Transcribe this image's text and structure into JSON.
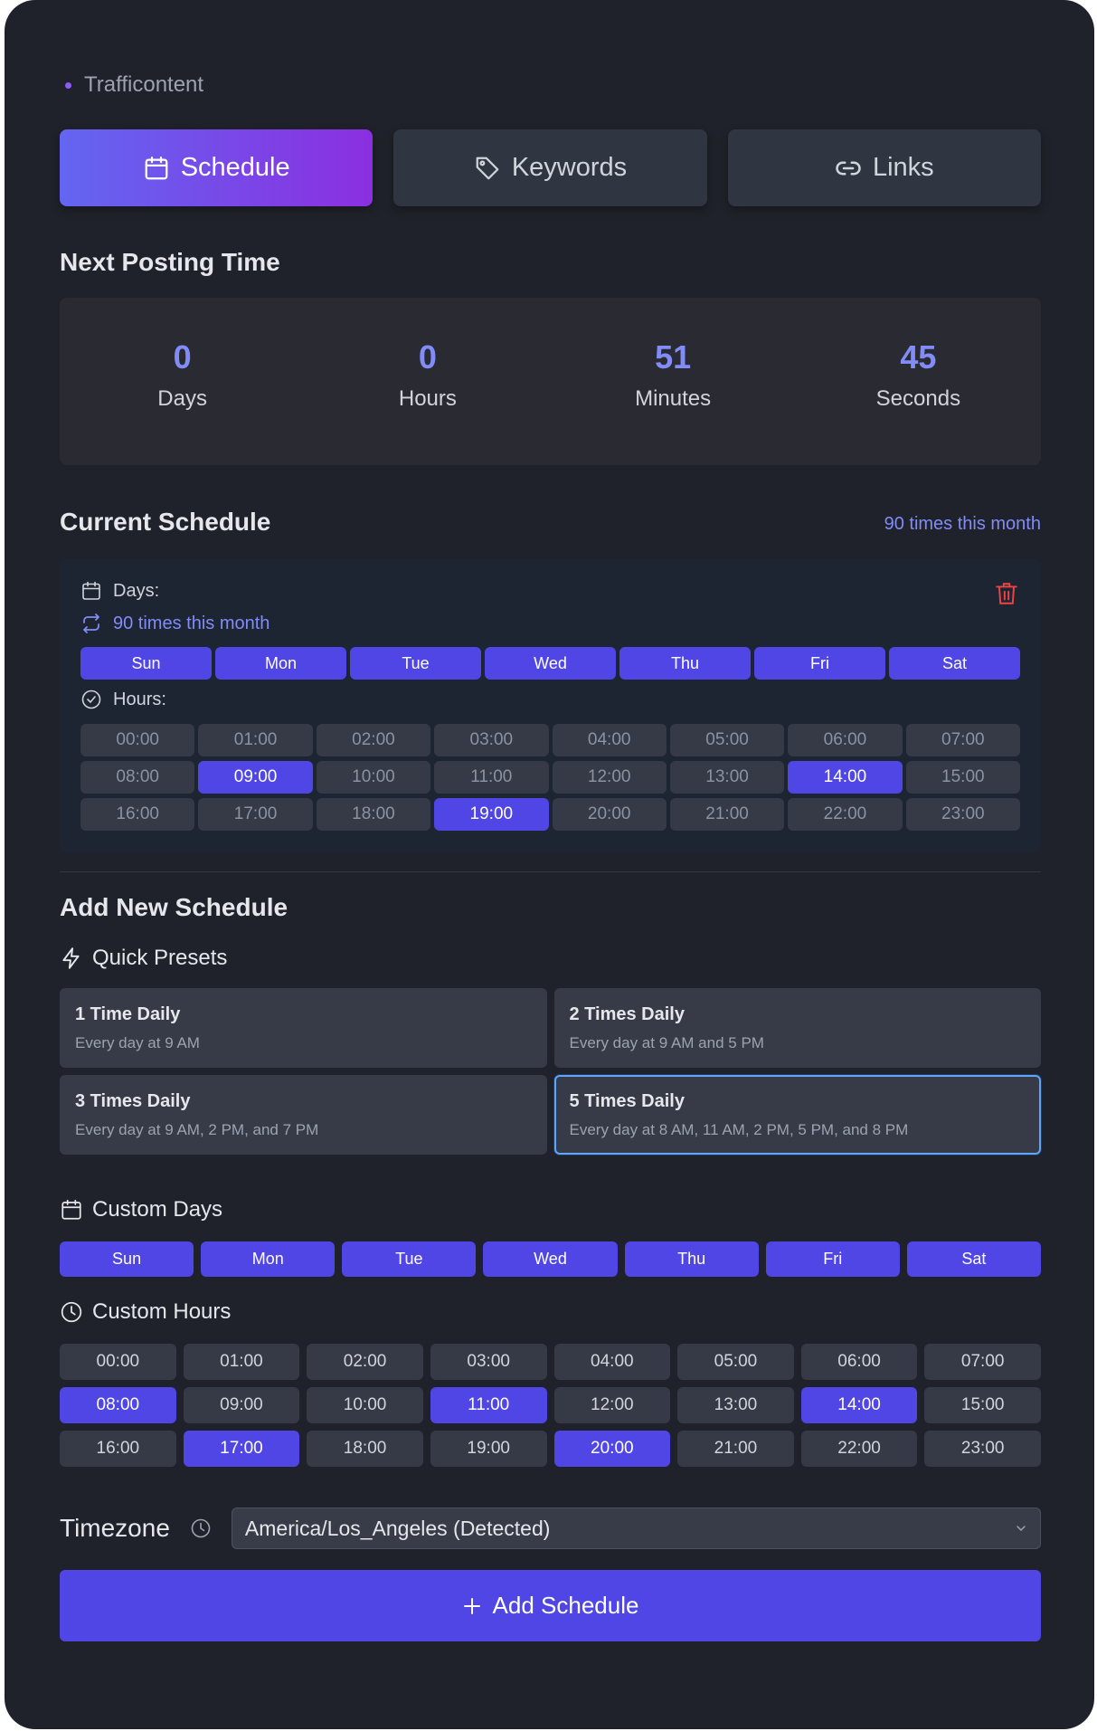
{
  "brand": {
    "name": "Trafficontent"
  },
  "tabs": [
    {
      "label": "Schedule",
      "icon": "calendar-icon",
      "active": true
    },
    {
      "label": "Keywords",
      "icon": "tag-icon",
      "active": false
    },
    {
      "label": "Links",
      "icon": "link-icon",
      "active": false
    }
  ],
  "next_posting": {
    "title": "Next Posting Time",
    "items": [
      {
        "value": "0",
        "label": "Days"
      },
      {
        "value": "0",
        "label": "Hours"
      },
      {
        "value": "51",
        "label": "Minutes"
      },
      {
        "value": "45",
        "label": "Seconds"
      }
    ]
  },
  "current_schedule": {
    "title": "Current Schedule",
    "summary": "90 times this month",
    "days_label": "Days:",
    "repeat_text": "90 times this month",
    "hours_label": "Hours:",
    "days": [
      "Sun",
      "Mon",
      "Tue",
      "Wed",
      "Thu",
      "Fri",
      "Sat"
    ],
    "hours": [
      "00:00",
      "01:00",
      "02:00",
      "03:00",
      "04:00",
      "05:00",
      "06:00",
      "07:00",
      "08:00",
      "09:00",
      "10:00",
      "11:00",
      "12:00",
      "13:00",
      "14:00",
      "15:00",
      "16:00",
      "17:00",
      "18:00",
      "19:00",
      "20:00",
      "21:00",
      "22:00",
      "23:00"
    ],
    "selected_hours": [
      "09:00",
      "14:00",
      "19:00"
    ]
  },
  "add_schedule": {
    "title": "Add New Schedule",
    "quick_presets_label": "Quick Presets",
    "presets": [
      {
        "title": "1 Time Daily",
        "desc": "Every day at 9 AM",
        "selected": false
      },
      {
        "title": "2 Times Daily",
        "desc": "Every day at 9 AM and 5 PM",
        "selected": false
      },
      {
        "title": "3 Times Daily",
        "desc": "Every day at 9 AM, 2 PM, and 7 PM",
        "selected": false
      },
      {
        "title": "5 Times Daily",
        "desc": "Every day at 8 AM, 11 AM, 2 PM, 5 PM, and 8 PM",
        "selected": true
      }
    ],
    "custom_days_label": "Custom Days",
    "custom_days": [
      "Sun",
      "Mon",
      "Tue",
      "Wed",
      "Thu",
      "Fri",
      "Sat"
    ],
    "custom_hours_label": "Custom Hours",
    "custom_hours": [
      "00:00",
      "01:00",
      "02:00",
      "03:00",
      "04:00",
      "05:00",
      "06:00",
      "07:00",
      "08:00",
      "09:00",
      "10:00",
      "11:00",
      "12:00",
      "13:00",
      "14:00",
      "15:00",
      "16:00",
      "17:00",
      "18:00",
      "19:00",
      "20:00",
      "21:00",
      "22:00",
      "23:00"
    ],
    "custom_selected_hours": [
      "08:00",
      "11:00",
      "14:00",
      "17:00",
      "20:00"
    ],
    "timezone_label": "Timezone",
    "timezone_value": "America/Los_Angeles (Detected)",
    "add_button": "Add Schedule"
  },
  "colors": {
    "accent": "#4f46e5",
    "accent_text": "#818cf8",
    "danger": "#ef4444",
    "selected_border": "#60a5fa"
  }
}
